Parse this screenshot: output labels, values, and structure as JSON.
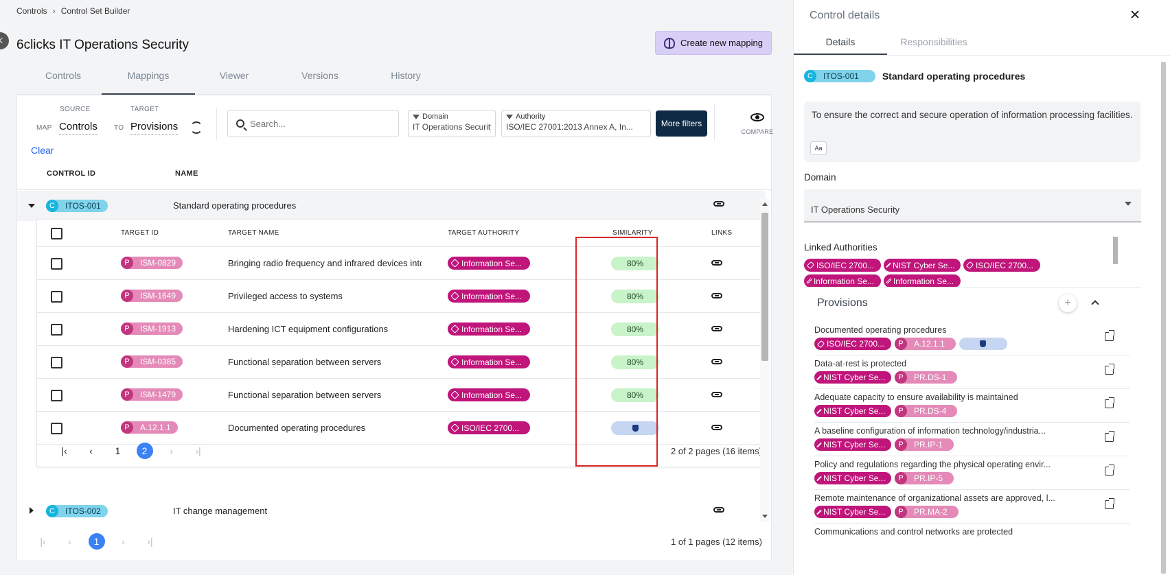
{
  "breadcrumb": {
    "root": "Controls",
    "current": "Control Set Builder"
  },
  "page": {
    "title": "6clicks IT Operations Security",
    "create_mapping_label": "Create new mapping"
  },
  "tabs": [
    "Controls",
    "Mappings",
    "Viewer",
    "Versions",
    "History"
  ],
  "active_tab": "Mappings",
  "mapping": {
    "source_label": "SOURCE",
    "target_label": "TARGET",
    "map_label": "MAP",
    "to_label": "TO",
    "source_value": "Controls",
    "target_value": "Provisions",
    "clear_label": "Clear"
  },
  "search": {
    "placeholder": "Search..."
  },
  "filters": {
    "domain_label": "Domain",
    "domain_value": "IT Operations Security",
    "authority_label": "Authority",
    "authority_value": "ISO/IEC 27001:2013 Annex A, In...",
    "more_label": "More filters",
    "compare_label": "COMPARE"
  },
  "outer_table": {
    "headers": {
      "control_id": "CONTROL ID",
      "name": "NAME"
    },
    "rows": [
      {
        "badge": "C",
        "id": "ITOS-001",
        "name": "Standard operating procedures",
        "expanded": true
      },
      {
        "badge": "C",
        "id": "ITOS-002",
        "name": "IT change management",
        "expanded": false
      }
    ],
    "pager": {
      "pages": [
        "1"
      ],
      "current": "1",
      "info": "1 of 1 pages (12 items)"
    }
  },
  "inner_table": {
    "headers": {
      "target_id": "TARGET ID",
      "target_name": "TARGET NAME",
      "target_authority": "TARGET AUTHORITY",
      "similarity": "SIMILARITY",
      "links": "LINKS"
    },
    "rows": [
      {
        "badge": "P",
        "id": "ISM-0829",
        "name": "Bringing radio frequency and infrared devices into",
        "authority": "Information Se...",
        "similarity": "80%"
      },
      {
        "badge": "P",
        "id": "ISM-1649",
        "name": "Privileged access to systems",
        "authority": "Information Se...",
        "similarity": "80%"
      },
      {
        "badge": "P",
        "id": "ISM-1913",
        "name": "Hardening ICT equipment configurations",
        "authority": "Information Se...",
        "similarity": "80%"
      },
      {
        "badge": "P",
        "id": "ISM-0385",
        "name": "Functional separation between servers",
        "authority": "Information Se...",
        "similarity": "80%"
      },
      {
        "badge": "P",
        "id": "ISM-1479",
        "name": "Functional separation between servers",
        "authority": "Information Se...",
        "similarity": "80%"
      },
      {
        "badge": "P",
        "id": "A.12.1.1",
        "name": "Documented operating procedures",
        "authority": "ISO/IEC 2700...",
        "similarity": "",
        "manual": true
      }
    ],
    "pager": {
      "pages": [
        "1",
        "2"
      ],
      "current": "2",
      "info": "2 of 2 pages (16 items)"
    }
  },
  "details": {
    "title": "Control details",
    "tabs": [
      "Details",
      "Responsibilities"
    ],
    "active_tab": "Details",
    "control_badge": "C",
    "control_id": "ITOS-001",
    "control_name": "Standard operating procedures",
    "description": "To ensure the correct and secure operation of information processing facilities.",
    "text_format_label": "Aa",
    "domain_label": "Domain",
    "domain_value": "IT Operations Security",
    "linked_authorities_label": "Linked Authorities",
    "linked_authorities": [
      "ISO/IEC 2700...",
      "NIST Cyber Se...",
      "ISO/IEC 2700...",
      "Information Se...",
      "Information Se..."
    ],
    "provisions_label": "Provisions",
    "provisions": [
      {
        "title": "Documented operating procedures",
        "authority": "ISO/IEC 2700...",
        "id": "A.12.1.1",
        "manual": true
      },
      {
        "title": "Data-at-rest is protected",
        "authority": "NIST Cyber Se...",
        "id": "PR.DS-1"
      },
      {
        "title": "Adequate capacity to ensure availability is maintained",
        "authority": "NIST Cyber Se...",
        "id": "PR.DS-4"
      },
      {
        "title": "A baseline configuration of information technology/industria...",
        "authority": "NIST Cyber Se...",
        "id": "PR.IP-1"
      },
      {
        "title": "Policy and regulations regarding the physical operating envir...",
        "authority": "NIST Cyber Se...",
        "id": "PR.IP-5"
      },
      {
        "title": "Remote maintenance of organizational assets are approved, l...",
        "authority": "NIST Cyber Se...",
        "id": "PR.MA-2"
      },
      {
        "title": "Communications and control networks are protected",
        "authority": "",
        "id": ""
      }
    ]
  },
  "colors": {
    "accent": "#3b82f6",
    "authority_badge": "#c0157a",
    "control_badge": "#16b5de",
    "highlight": "#dc2626"
  }
}
